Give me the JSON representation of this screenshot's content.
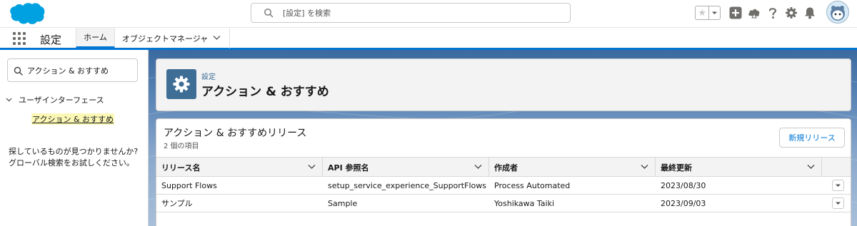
{
  "header": {
    "search_placeholder": "[設定] を検索"
  },
  "app_nav": {
    "app_name": "設定",
    "tabs": [
      {
        "label": "ホーム"
      },
      {
        "label": "オブジェクトマネージャ"
      }
    ]
  },
  "sidebar": {
    "quickfind_value": "アクション & おすすめ",
    "tree_parent": "ユーザインターフェース",
    "tree_child": "アクション & おすすめ",
    "not_found_line1": "探しているものが見つかりませんか?",
    "not_found_line2": "グローバル検索をお試しください。"
  },
  "page_header": {
    "breadcrumb": "設定",
    "title": "アクション & おすすめ"
  },
  "card": {
    "title": "アクション & おすすめリリース",
    "subtitle": "2 個の項目",
    "new_button": "新規リリース",
    "columns": [
      "リリース名",
      "API 参照名",
      "作成者",
      "最終更新"
    ],
    "rows": [
      [
        "Support Flows",
        "setup_service_experience_SupportFlows",
        "Process Automated",
        "2023/08/30"
      ],
      [
        "サンプル",
        "Sample",
        "Yoshikawa Taiki",
        "2023/09/03"
      ]
    ]
  },
  "colors": {
    "brand_blue": "#0176d3",
    "salesforce_cloud": "#00a1e0",
    "setup_icon_bg": "#3e6d96",
    "highlight": "#fbf8b6"
  },
  "icons": [
    "salesforce-logo",
    "search-icon",
    "star-icon",
    "add-icon",
    "trailhead-icon",
    "help-icon",
    "gear-icon",
    "bell-icon",
    "avatar-astro",
    "app-launcher-icon",
    "chevron-down-icon"
  ]
}
